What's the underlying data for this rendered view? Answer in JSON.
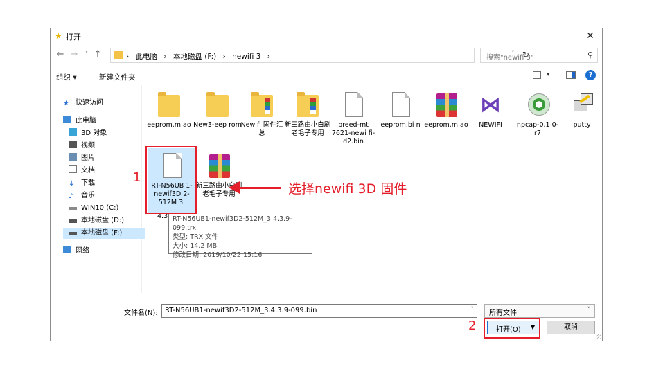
{
  "window": {
    "title": "打开"
  },
  "address": {
    "crumbs": [
      "此电脑",
      "›",
      "本地磁盘 (F:)",
      "›",
      "newifi 3",
      "›"
    ],
    "search_placeholder": "搜索\"newifi 3\""
  },
  "toolbar": {
    "organize": "组织 ▾",
    "new_folder": "新建文件夹"
  },
  "sidebar": {
    "items": [
      {
        "label": "快速访问"
      },
      {
        "label": "此电脑"
      },
      {
        "label": "3D 对象"
      },
      {
        "label": "视频"
      },
      {
        "label": "图片"
      },
      {
        "label": "文档"
      },
      {
        "label": "下载"
      },
      {
        "label": "音乐"
      },
      {
        "label": "WIN10 (C:)"
      },
      {
        "label": "本地磁盘 (D:)"
      },
      {
        "label": "本地磁盘 (F:)"
      },
      {
        "label": "网络"
      }
    ]
  },
  "files": {
    "row1": [
      {
        "name": "eeprom.m ao",
        "type": "folder"
      },
      {
        "name": "New3-eep rom",
        "type": "folder"
      },
      {
        "name": "Newifi 固件汇总",
        "type": "folder-color"
      },
      {
        "name": "新三路由小白刷老毛子专用",
        "type": "folder-color"
      },
      {
        "name": "breed-mt 7621-newi fi-d2.bin",
        "type": "doc"
      },
      {
        "name": "eeprom.bi n",
        "type": "doc"
      },
      {
        "name": "eeprom.m ao",
        "type": "rar"
      },
      {
        "name": "NEWIFI",
        "type": "vs"
      },
      {
        "name": "npcap-0.1 0-r7",
        "type": "disc"
      },
      {
        "name": "putty",
        "type": "putty"
      }
    ],
    "row2": [
      {
        "name": "RT-N56UB 1-newif3D 2-512M 3.",
        "type": "doc"
      },
      {
        "name": "新三路由小白刷老毛子专用",
        "type": "rar"
      }
    ],
    "partial_label": "4.3"
  },
  "tooltip": {
    "line1": "RT-N56UB1-newif3D2-512M_3.4.3.9-099.trx",
    "line2": "类型: TRX 文件",
    "line3": "大小: 14.2 MB",
    "line4": "修改日期: 2019/10/22 15:16"
  },
  "bottom": {
    "filename_label": "文件名(N):",
    "filename_value": "RT-N56UB1-newif3D2-512M_3.4.3.9-099.bin",
    "filter_value": "所有文件",
    "open_label": "打开(O)",
    "cancel_label": "取消"
  },
  "annotations": {
    "step1": "1",
    "step1_text": "选择newifi 3D 固件",
    "step2": "2",
    "color": "#e41e2a"
  }
}
